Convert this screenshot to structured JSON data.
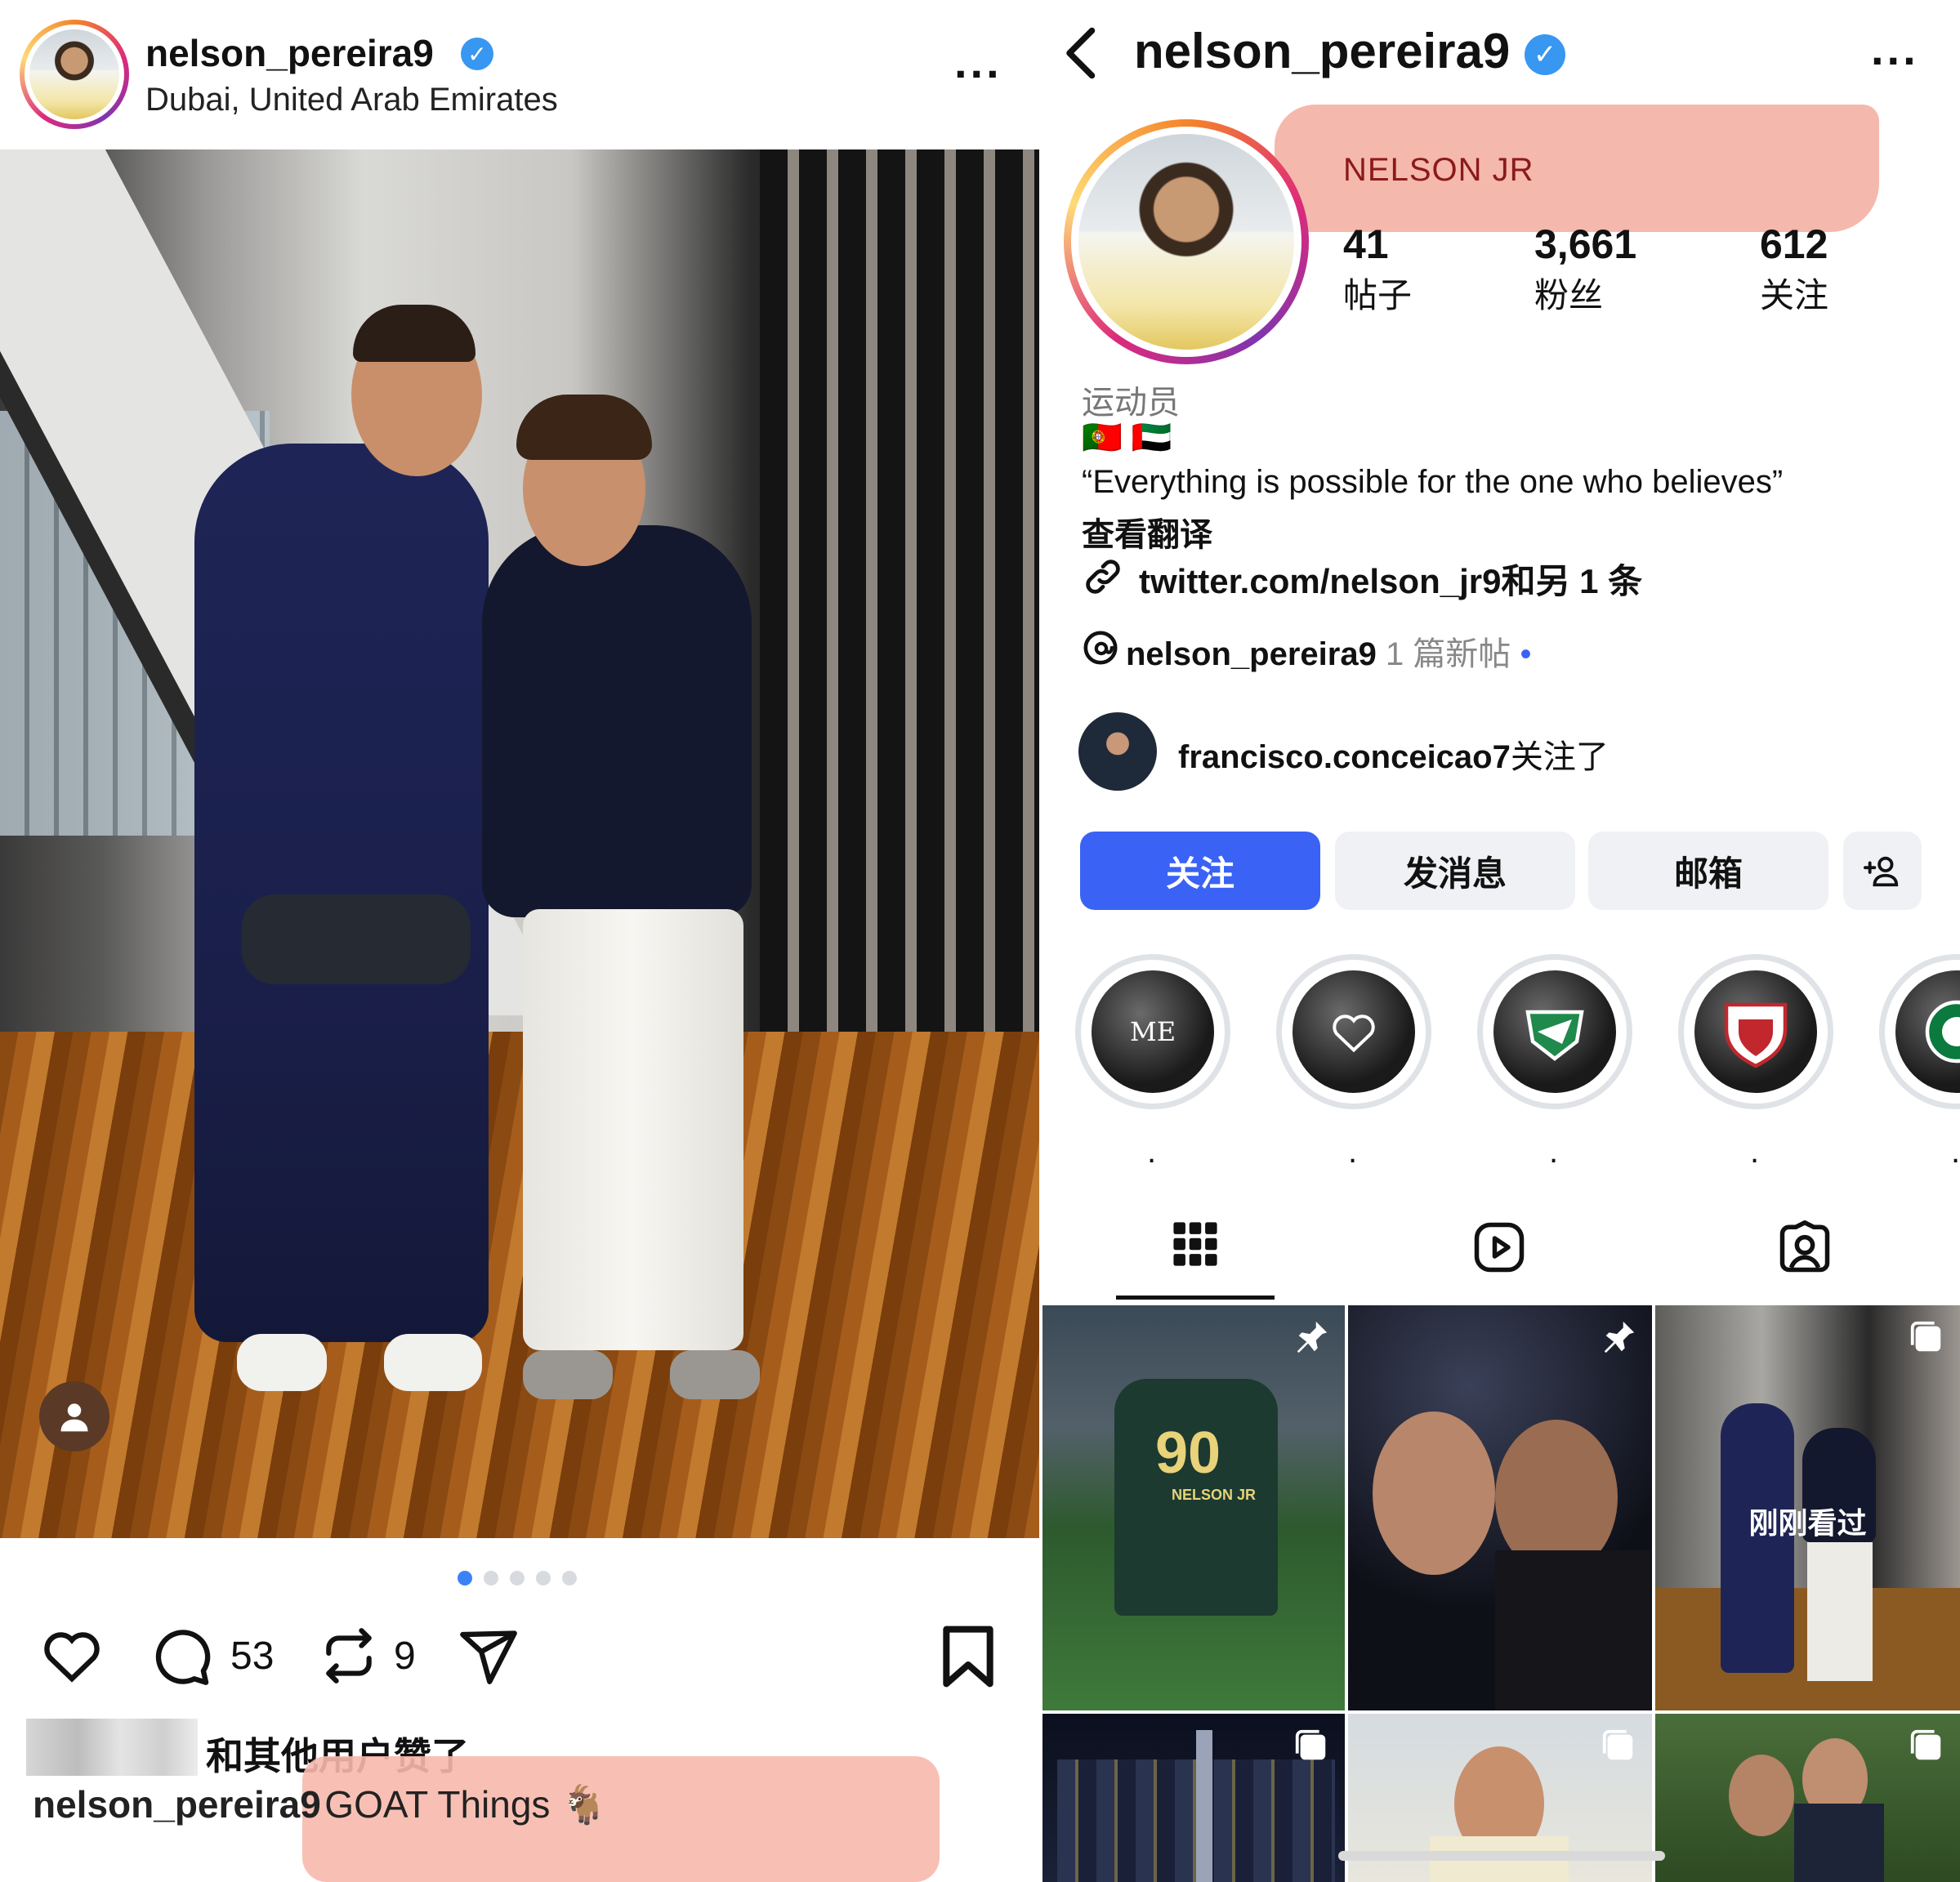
{
  "left_post": {
    "username": "nelson_pereira9",
    "location": "Dubai, United Arab Emirates",
    "more_label": "...",
    "photo_dots": 5,
    "photo_dot_active": 1,
    "comments_count": "53",
    "reposts_count": "9",
    "liked_by_text": "和其他用户赞了",
    "caption_username": "nelson_pereira9",
    "caption_text": "GOAT Things 🐐"
  },
  "profile": {
    "back_label": "<",
    "username": "nelson_pereira9",
    "more_label": "...",
    "display_name": "NELSON JR",
    "stats": [
      {
        "value": "41",
        "label": "帖子"
      },
      {
        "value": "3,661",
        "label": "粉丝"
      },
      {
        "value": "612",
        "label": "关注"
      }
    ],
    "category": "运动员",
    "flags": "🇵🇹 🇦🇪",
    "bio_quote": "“Everything is possible for the one who believes”",
    "translate_label": "查看翻译",
    "link_text": "twitter.com/nelson_jr9",
    "link_more": "和另 1 条",
    "threads_user": "nelson_pereira9",
    "threads_note": "1 篇新帖",
    "followed_by_user": "francisco.conceicao7",
    "followed_by_suffix": "关注了",
    "buttons": {
      "follow": "关注",
      "message": "发消息",
      "email": "邮箱",
      "add_person": "+&"
    },
    "highlights": [
      {
        "label": "ME",
        "icon": "text-me"
      },
      {
        "label": "",
        "icon": "heart-icon"
      },
      {
        "label": "",
        "icon": "green-club-crest"
      },
      {
        "label": "",
        "icon": "santa-clara-crest"
      },
      {
        "label": "",
        "icon": "sporting-crest"
      }
    ],
    "tabs": [
      "grid-icon",
      "reels-icon",
      "tagged-icon"
    ],
    "grid_seen_label": "刚刚看过",
    "jersey_number": "90",
    "jersey_name": "NELSON JR"
  },
  "colors": {
    "follow_blue": "#3a62f5",
    "verified_blue": "#3897f0",
    "highlight_bg": "#f4b4a8",
    "display_name_color": "#8b1a1a"
  }
}
